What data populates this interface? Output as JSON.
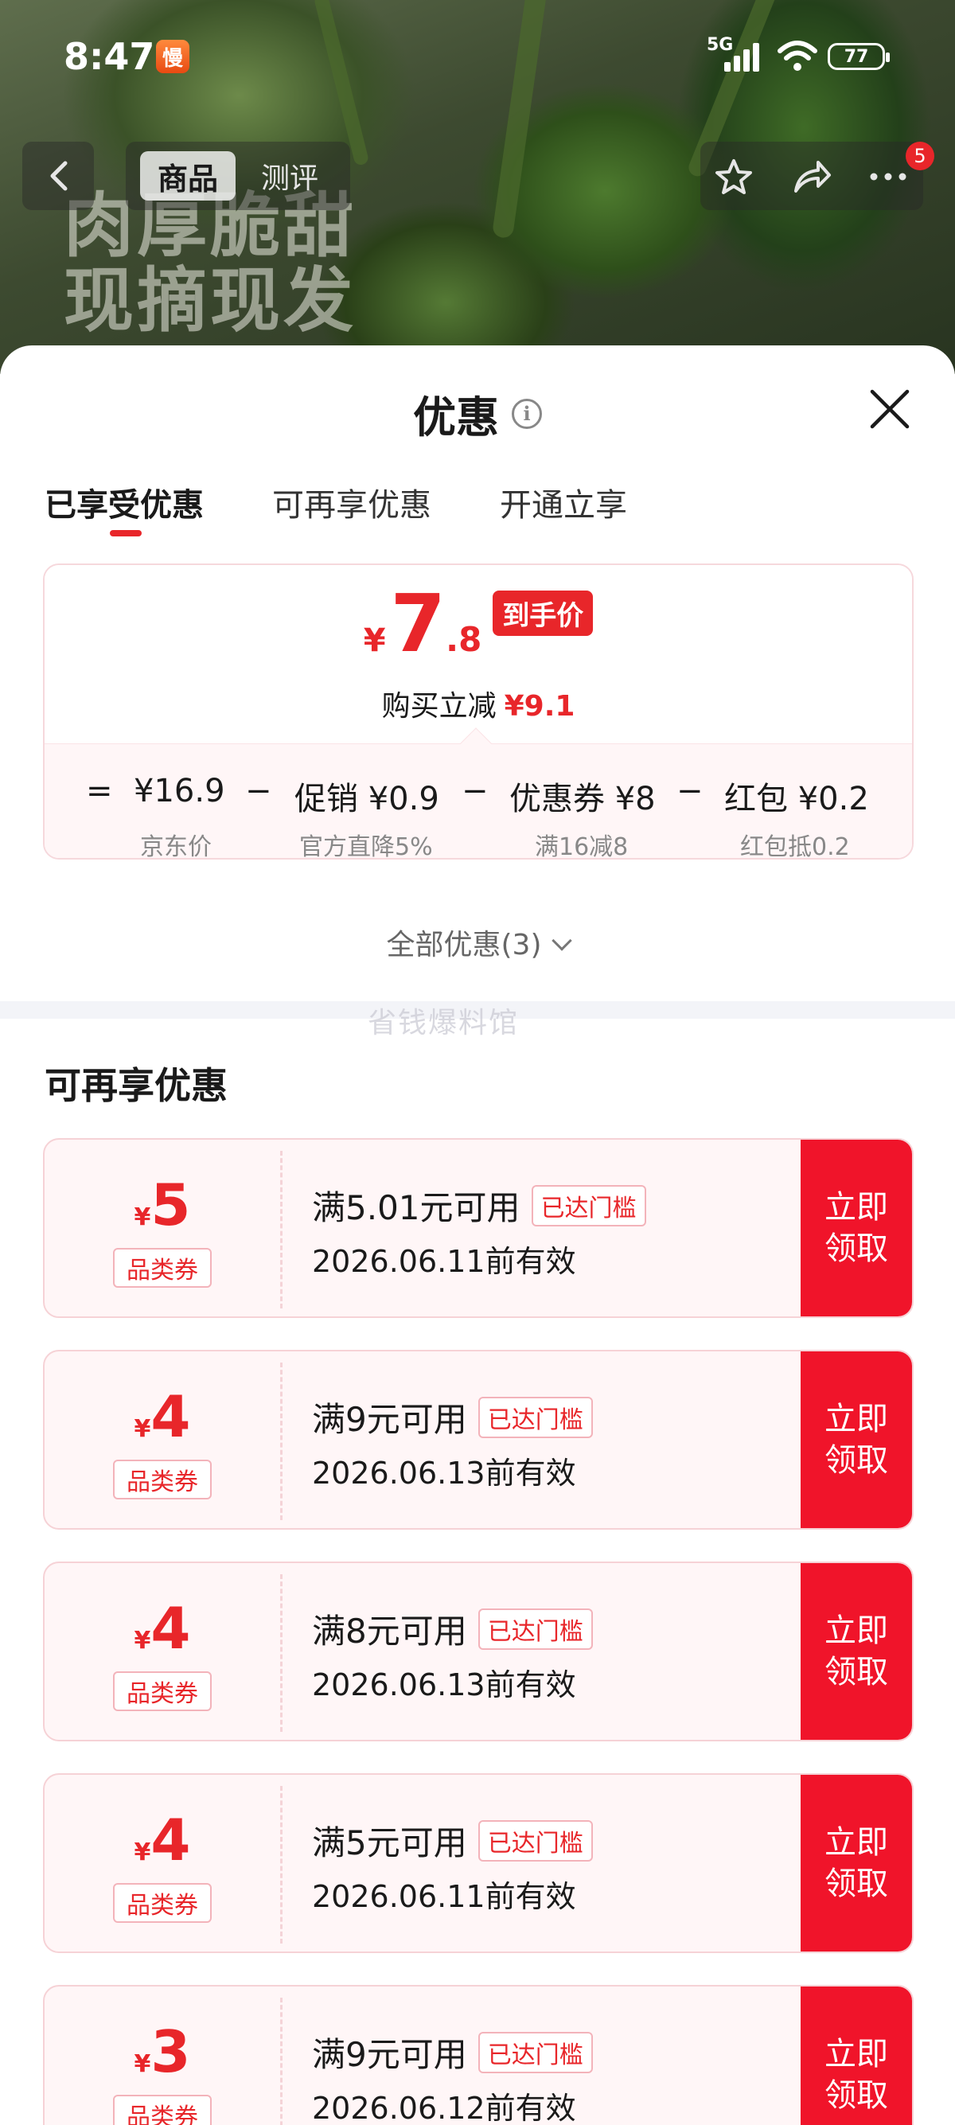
{
  "status_bar": {
    "time": "8:47",
    "app_badge": "慢",
    "network": "5G",
    "battery": "77"
  },
  "hero": {
    "line1": "肉厚脆甜",
    "line2": "现摘现发"
  },
  "top_nav": {
    "tab_product": "商品",
    "tab_review": "测评",
    "message_count": "5"
  },
  "sheet": {
    "title": "优惠",
    "tabs": [
      "已享受优惠",
      "可再享优惠",
      "开通立享"
    ],
    "summary": {
      "price_yen": "¥",
      "price_int": "7",
      "price_dec": ".8",
      "price_tag": "到手价",
      "reduce_label": "购买立减",
      "reduce_value": "¥9.1"
    },
    "formula": [
      {
        "op": "=",
        "label": "¥16.9",
        "sub": "京东价"
      },
      {
        "op": "−",
        "label": "促销 ¥0.9",
        "sub": "官方直降5%"
      },
      {
        "op": "−",
        "label": "优惠券 ¥8",
        "sub": "满16减8"
      },
      {
        "op": "−",
        "label": "红包 ¥0.2",
        "sub": "红包抵0.2"
      }
    ],
    "all_deals": "全部优惠(3)",
    "watermark": "省钱爆料馆",
    "section_title": "可再享优惠",
    "coupons": [
      {
        "amount": "5",
        "type": "品类券",
        "condition": "满5.01元可用",
        "badge": "已达门槛",
        "valid": "2026.06.11前有效",
        "btn1": "立即",
        "btn2": "领取"
      },
      {
        "amount": "4",
        "type": "品类券",
        "condition": "满9元可用",
        "badge": "已达门槛",
        "valid": "2026.06.13前有效",
        "btn1": "立即",
        "btn2": "领取"
      },
      {
        "amount": "4",
        "type": "品类券",
        "condition": "满8元可用",
        "badge": "已达门槛",
        "valid": "2026.06.13前有效",
        "btn1": "立即",
        "btn2": "领取"
      },
      {
        "amount": "4",
        "type": "品类券",
        "condition": "满5元可用",
        "badge": "已达门槛",
        "valid": "2026.06.11前有效",
        "btn1": "立即",
        "btn2": "领取"
      },
      {
        "amount": "3",
        "type": "品类券",
        "condition": "满9元可用",
        "badge": "已达门槛",
        "valid": "2026.06.12前有效",
        "btn1": "立即",
        "btn2": "领取"
      }
    ],
    "coupon_yen": "¥"
  },
  "colors": {
    "accent_red": "#e8262a",
    "button_red": "#f0142a",
    "coupon_bg": "#fff6f7"
  },
  "icons": [
    "back-arrow-icon",
    "star-icon",
    "share-icon",
    "more-icon",
    "info-icon",
    "close-icon",
    "chevron-down-icon",
    "wifi-icon",
    "signal-icon",
    "battery-icon"
  ]
}
